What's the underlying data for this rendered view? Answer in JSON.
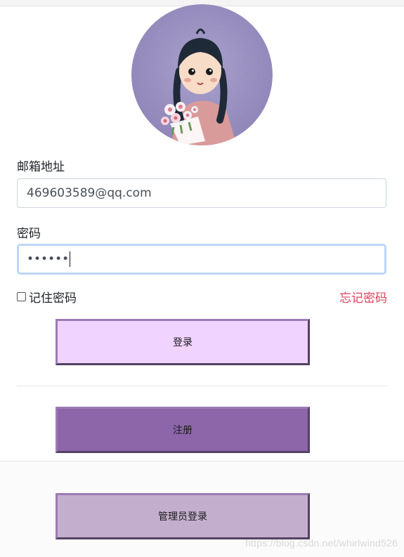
{
  "form": {
    "email_label": "邮箱地址",
    "email_value": "469603589@qq.com",
    "password_label": "密码",
    "password_masked": "••••••",
    "remember_label": "记住密码",
    "forgot_label": "忘记密码"
  },
  "buttons": {
    "login": "登录",
    "register": "注册",
    "admin_login": "管理员登录"
  },
  "watermark": "https://blog.csdn.net/whirlwind526",
  "colors": {
    "login_bg": "#f0d3ff",
    "register_bg": "#8c66a9",
    "admin_bg": "#c3afcd",
    "forgot_text": "#e0405a",
    "focus_ring": "#bcd6f5"
  },
  "icons": {
    "avatar": "girl-with-flowers-avatar",
    "checkbox": "checkbox-unchecked"
  }
}
